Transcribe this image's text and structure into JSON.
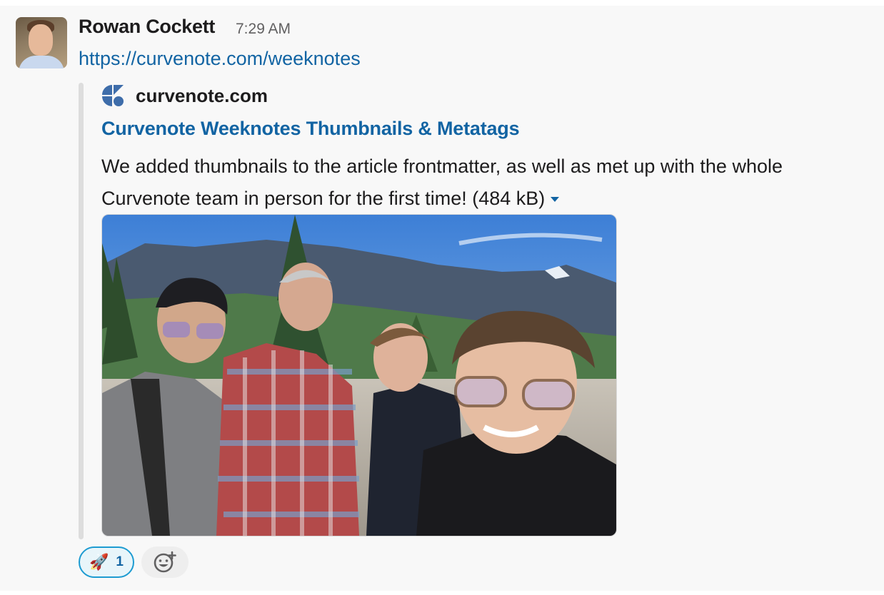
{
  "message": {
    "sender": "Rowan Cockett",
    "time": "7:29 AM",
    "link_text": "https://curvenote.com/weeknotes"
  },
  "unfurl": {
    "site_name": "curvenote.com",
    "title": "Curvenote Weeknotes Thumbnails & Metatags",
    "description": "We added thumbnails to the article frontmatter, as well as met up with the whole Curvenote team in person for the first time! (484 kB)",
    "logo_icon": "curvenote-logo-icon",
    "image_icon": "group-photo-mountains",
    "expand_icon": "caret-down-icon"
  },
  "reactions": [
    {
      "emoji": "🚀",
      "count": "1",
      "active": true
    }
  ],
  "add_reaction_icon": "add-reaction-icon",
  "colors": {
    "link": "#1264a3",
    "reaction_border": "#1d9bd1",
    "reaction_bg": "#e8f5fa",
    "background": "#f8f8f8"
  }
}
